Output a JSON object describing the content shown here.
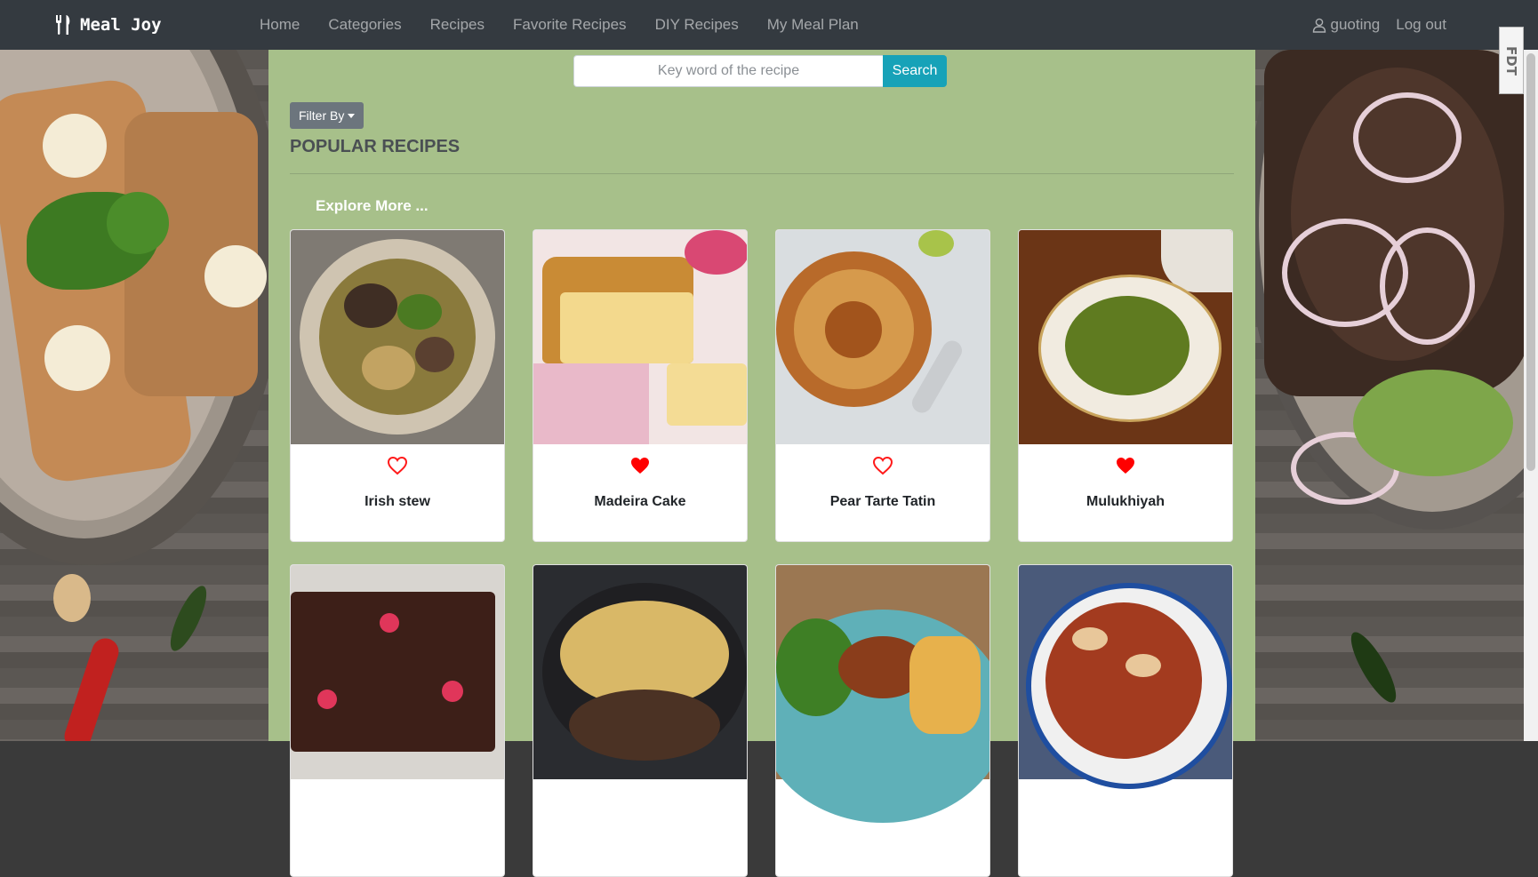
{
  "brand": {
    "name": "Meal Joy",
    "icon": "utensils-icon"
  },
  "nav": {
    "links": [
      "Home",
      "Categories",
      "Recipes",
      "Favorite Recipes",
      "DIY Recipes",
      "My Meal Plan"
    ],
    "user": "guoting",
    "logout": "Log out"
  },
  "search": {
    "placeholder": "Key word of the recipe",
    "button": "Search"
  },
  "filter": {
    "label": "Filter By"
  },
  "section": {
    "title": "POPULAR RECIPES",
    "explore": "Explore More ..."
  },
  "extension_badge": "FDT",
  "recipes": [
    {
      "name": "Irish stew",
      "favorite": false
    },
    {
      "name": "Madeira Cake",
      "favorite": true
    },
    {
      "name": "Pear Tarte Tatin",
      "favorite": false
    },
    {
      "name": "Mulukhiyah",
      "favorite": true
    },
    {
      "name": "",
      "favorite": false
    },
    {
      "name": "",
      "favorite": false
    },
    {
      "name": "",
      "favorite": false
    },
    {
      "name": "",
      "favorite": false
    }
  ],
  "colors": {
    "navbar": "#343a40",
    "main_bg": "#a7c08a",
    "search_button": "#17a2b8",
    "heart": "#ff0000"
  }
}
